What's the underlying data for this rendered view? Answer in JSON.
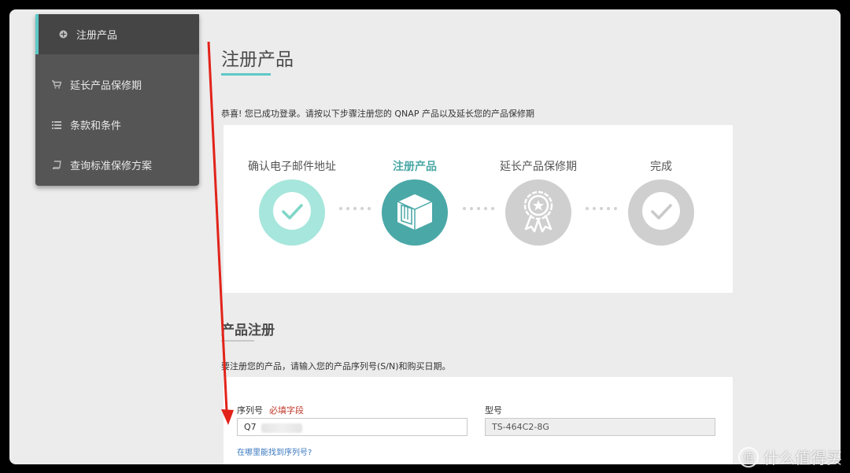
{
  "sidebar": {
    "items": [
      {
        "label": "注册产品",
        "icon": "plus-circle-icon"
      },
      {
        "label": "延长产品保修期",
        "icon": "cart-icon"
      },
      {
        "label": "条款和条件",
        "icon": "list-icon"
      },
      {
        "label": "查询标准保修方案",
        "icon": "book-icon"
      }
    ]
  },
  "main": {
    "title": "注册产品",
    "intro": "恭喜! 您已成功登录。请按以下步骤注册您的 QNAP 产品以及延长您的产品保修期",
    "steps": [
      {
        "label": "确认电子邮件地址",
        "icon": "check-icon",
        "state": "done"
      },
      {
        "label": "注册产品",
        "icon": "nas-box-icon",
        "state": "current"
      },
      {
        "label": "延长产品保修期",
        "icon": "award-ribbon-icon",
        "state": "pending"
      },
      {
        "label": "完成",
        "icon": "check-icon",
        "state": "pending"
      }
    ],
    "section_title": "产品注册",
    "section_intro": "要注册您的产品，请输入您的产品序列号(S/N)和购买日期。",
    "form": {
      "serial_label": "序列号",
      "required_text": "必填字段",
      "serial_value": "Q7",
      "model_label": "型号",
      "model_value": "TS-464C2-8G",
      "help_link": "在哪里能找到序列号?"
    }
  },
  "watermark": {
    "logo": "值",
    "text": "什么值得买"
  },
  "colors": {
    "accent": "#5ec8c6",
    "step_done": "#a7e6dc",
    "step_current": "#4aa8a7",
    "step_pending": "#cfcfcf",
    "sidebar_bg": "#555556",
    "annotation_arrow": "#e2231a"
  }
}
